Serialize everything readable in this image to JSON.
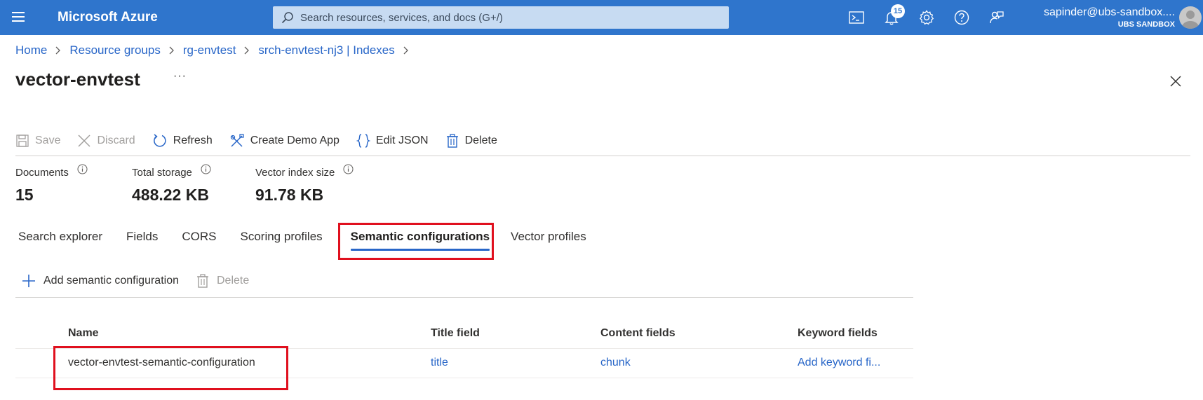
{
  "topbar": {
    "brand": "Microsoft Azure",
    "search_placeholder": "Search resources, services, and docs (G+/)",
    "notification_count": "15",
    "account_email": "sapinder@ubs-sandbox....",
    "account_tenant": "UBS SANDBOX",
    "icons": [
      "menu-icon",
      "cloud-shell-icon",
      "bell-icon",
      "settings-icon",
      "help-icon",
      "feedback-icon"
    ],
    "colors": {
      "bar": "#2f75cc",
      "search": "#c7dbf2"
    }
  },
  "breadcrumb": [
    "Home",
    "Resource groups",
    "rg-envtest",
    "srch-envtest-nj3 | Indexes"
  ],
  "page": {
    "title": "vector-envtest",
    "more": "···"
  },
  "toolbar": {
    "save": "Save",
    "discard": "Discard",
    "refresh": "Refresh",
    "create_demo_app": "Create Demo App",
    "edit_json": "Edit JSON",
    "delete": "Delete"
  },
  "metrics": [
    {
      "label": "Documents",
      "value": "15"
    },
    {
      "label": "Total storage",
      "value": "488.22 KB"
    },
    {
      "label": "Vector index size",
      "value": "91.78 KB"
    }
  ],
  "tabs": [
    "Search explorer",
    "Fields",
    "CORS",
    "Scoring profiles",
    "Semantic configurations",
    "Vector profiles"
  ],
  "active_tab": "Semantic configurations",
  "subtoolbar": {
    "add": "Add semantic configuration",
    "delete": "Delete"
  },
  "grid": {
    "columns": [
      "Name",
      "Title field",
      "Content fields",
      "Keyword fields"
    ],
    "rows": [
      {
        "name": "vector-envtest-semantic-configuration",
        "title_field": "title",
        "content_fields": "chunk",
        "keyword_fields": "Add keyword fi..."
      }
    ]
  },
  "accent_colors": {
    "link": "#2866c8",
    "highlight": "#e0101e"
  }
}
